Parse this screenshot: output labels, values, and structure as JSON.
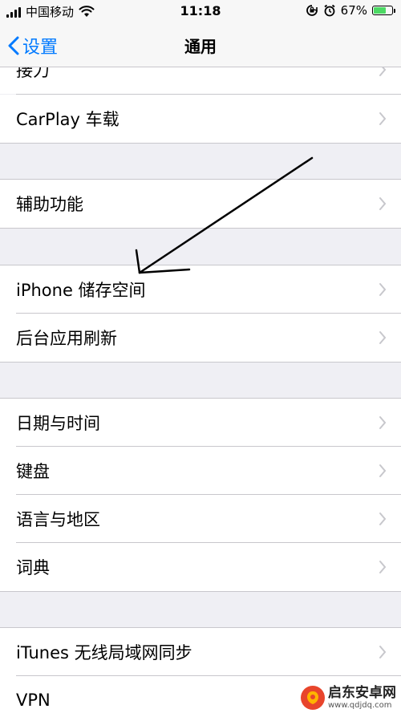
{
  "status_bar": {
    "carrier": "中国移动",
    "time": "11:18",
    "battery_percent": "67%",
    "battery_level": 0.67,
    "icons": [
      "signal-bars-icon",
      "wifi-icon",
      "orientation-lock-icon",
      "alarm-icon",
      "battery-icon"
    ]
  },
  "nav": {
    "back_label": "设置",
    "title": "通用"
  },
  "settings": {
    "partial_label": "接力",
    "carplay": "CarPlay 车载",
    "accessibility": "辅助功能",
    "iphone_storage": "iPhone 储存空间",
    "background_refresh": "后台应用刷新",
    "date_time": "日期与时间",
    "keyboard": "键盘",
    "language_region": "语言与地区",
    "dictionary": "词典",
    "itunes_wifi_sync": "iTunes 无线局域网同步",
    "vpn": "VPN"
  },
  "watermark": {
    "title": "启东安卓网",
    "url": "www.qdjdq.com"
  },
  "colors": {
    "accent": "#007aff",
    "background": "#efeff4",
    "row": "#ffffff",
    "separator": "#c8c7cc",
    "chevron": "#c7c7cc",
    "battery_green": "#4cd964"
  }
}
